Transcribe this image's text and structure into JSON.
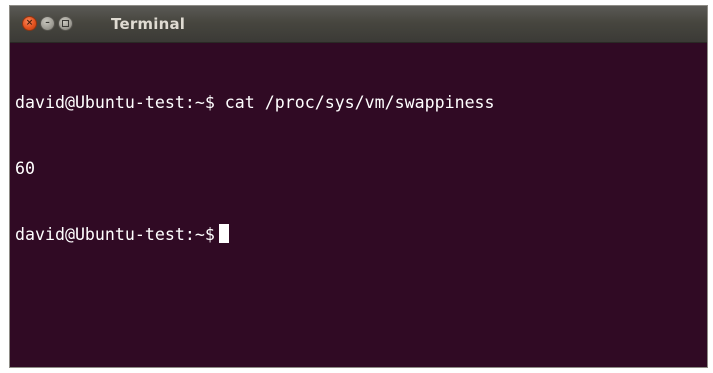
{
  "window": {
    "title": "Terminal",
    "close_glyph": "×",
    "minimize_glyph": "–"
  },
  "terminal": {
    "lines": [
      {
        "prompt": "david@Ubuntu-test:~$",
        "command": " cat /proc/sys/vm/swappiness"
      },
      {
        "output": "60"
      },
      {
        "prompt": "david@Ubuntu-test:~$",
        "command": ""
      }
    ]
  },
  "colors": {
    "terminal_background": "#300a24",
    "terminal_text": "#ffffff",
    "titlebar": "#47463f",
    "close_button": "#e4521f"
  },
  "icons": [
    "close-icon",
    "minimize-icon",
    "maximize-icon"
  ]
}
